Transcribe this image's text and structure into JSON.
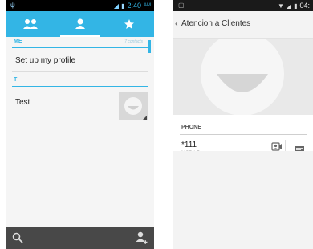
{
  "contacts_screen": {
    "status_time": "2:40",
    "status_ampm": "AM",
    "tabs": [
      {
        "name": "groups",
        "icon": "groups-icon"
      },
      {
        "name": "all-contacts",
        "icon": "person-icon",
        "active": true
      },
      {
        "name": "favorites",
        "icon": "star-icon"
      }
    ],
    "me_section": {
      "letter": "ME",
      "count": "7 contacts"
    },
    "profile_label": "Set up my profile",
    "t_section": {
      "letter": "T"
    },
    "contacts": [
      {
        "name": "Test"
      }
    ],
    "bottom_bar": {
      "search_icon": "search-icon",
      "add_icon": "add-contact-icon"
    }
  },
  "details_screen": {
    "status_time": "04:",
    "back_symbol": "‹",
    "contact_name": "Atencion a Clientes",
    "phone_section_label": "PHONE",
    "phone_number": "*111",
    "phone_type": "MOBILE",
    "action_icons": [
      "video-call-icon",
      "message-icon"
    ]
  },
  "colors": {
    "accent": "#33b5e5",
    "bottom_bar": "#484848",
    "status_bar": "#000000"
  }
}
